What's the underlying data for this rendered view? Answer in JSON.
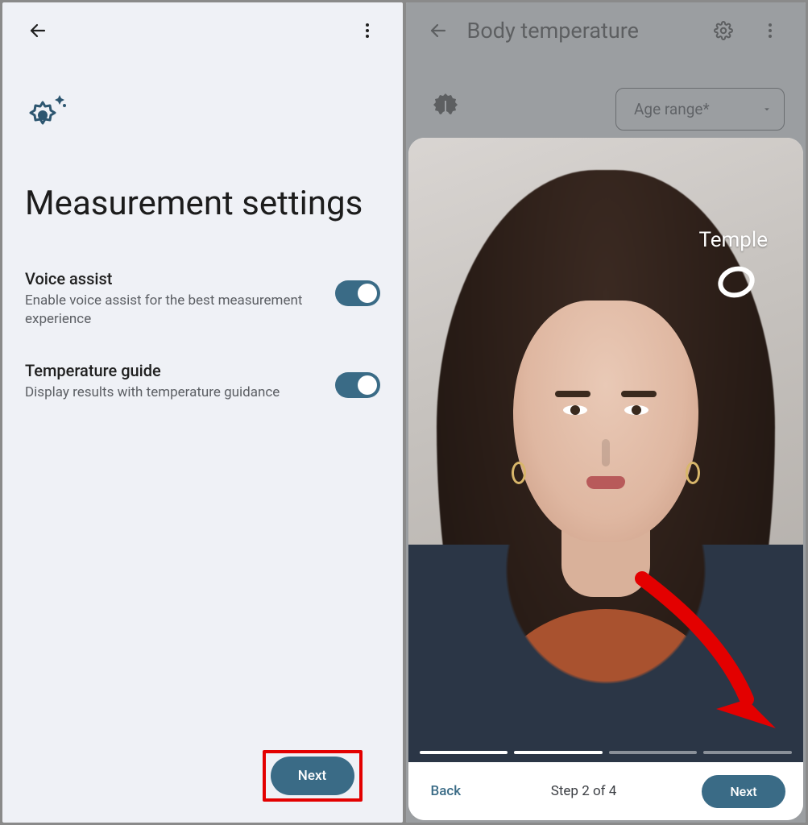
{
  "left": {
    "title": "Measurement settings",
    "settings": [
      {
        "title": "Voice assist",
        "desc": "Enable voice assist for the best measurement experience",
        "on": true
      },
      {
        "title": "Temperature guide",
        "desc": "Display results with temperature guidance",
        "on": true
      }
    ],
    "next_label": "Next"
  },
  "right": {
    "header_title": "Body temperature",
    "dropdown_label": "Age range*",
    "temple_label": "Temple",
    "step_label": "Step 2 of 4",
    "back_label": "Back",
    "next_label": "Next",
    "progress_total": 4,
    "progress_active": 2
  },
  "colors": {
    "accent": "#3a6b86",
    "highlight": "#e30000"
  }
}
